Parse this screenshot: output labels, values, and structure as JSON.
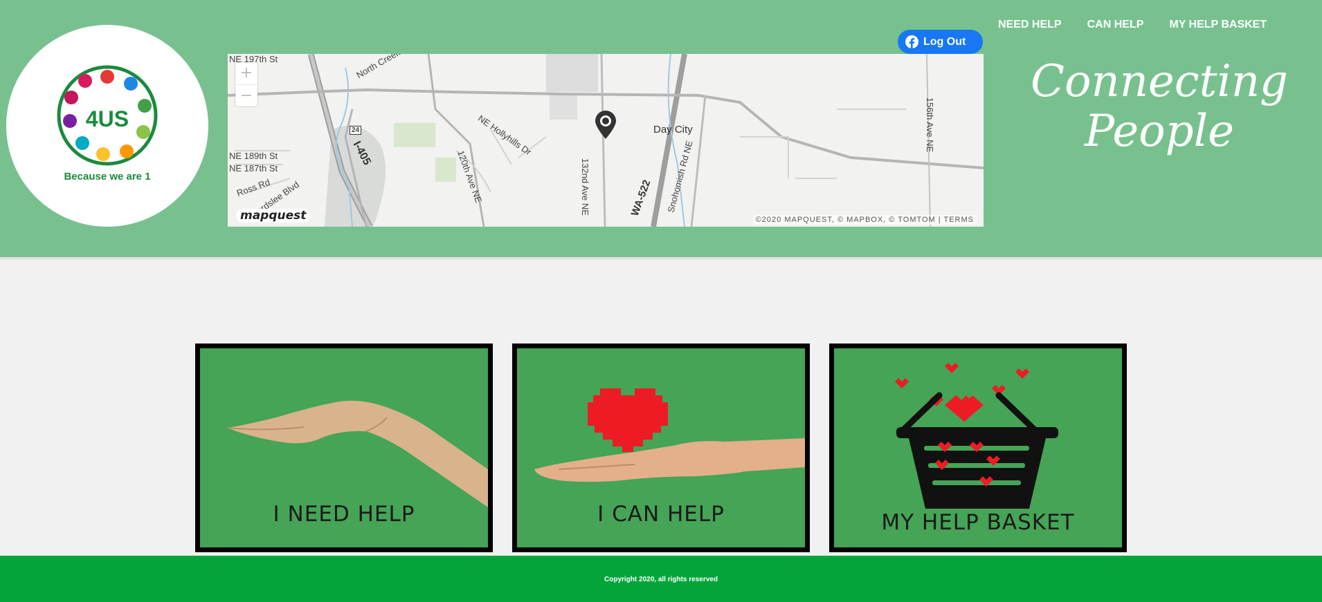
{
  "header": {
    "logo": {
      "mark_text": "4US",
      "tagline": "Because we are 1"
    },
    "facebook_button": {
      "label": "Log Out",
      "icon": "facebook-icon",
      "color": "#1877f2"
    },
    "nav": [
      {
        "label": "NEED HELP"
      },
      {
        "label": "CAN HELP"
      },
      {
        "label": "MY HELP BASKET"
      }
    ],
    "tagline_line1": "Connecting",
    "tagline_line2": "People",
    "colors": {
      "header_bg": "#78c18f",
      "logo_green": "#1a8a3a"
    }
  },
  "map": {
    "zoom_in_label": "+",
    "zoom_out_label": "−",
    "brand": "mapquest",
    "credit": "©2020 MAPQUEST, © MAPBOX, © TOMTOM | TERMS",
    "place_label": "Day City",
    "street_labels": [
      "NE 197th St",
      "NE 189th St",
      "NE 187th St",
      "Ross Rd",
      "Beardslee Blvd",
      "I-405",
      "NE Hollyhills Dr",
      "120th Ave NE",
      "132nd Ave NE",
      "WA-522",
      "Snohomish Rd NE",
      "156th Ave NE",
      "North Creek Pkwy",
      "24"
    ]
  },
  "cards": [
    {
      "title": "I NEED HELP",
      "icon": "open-hand-icon"
    },
    {
      "title": "I CAN HELP",
      "icon": "hand-with-heart-icon"
    },
    {
      "title": "MY HELP BASKET",
      "icon": "basket-with-hearts-icon"
    }
  ],
  "footer": {
    "text": "Copyright 2020, all rights reserved",
    "bg_color": "#03a53b"
  }
}
